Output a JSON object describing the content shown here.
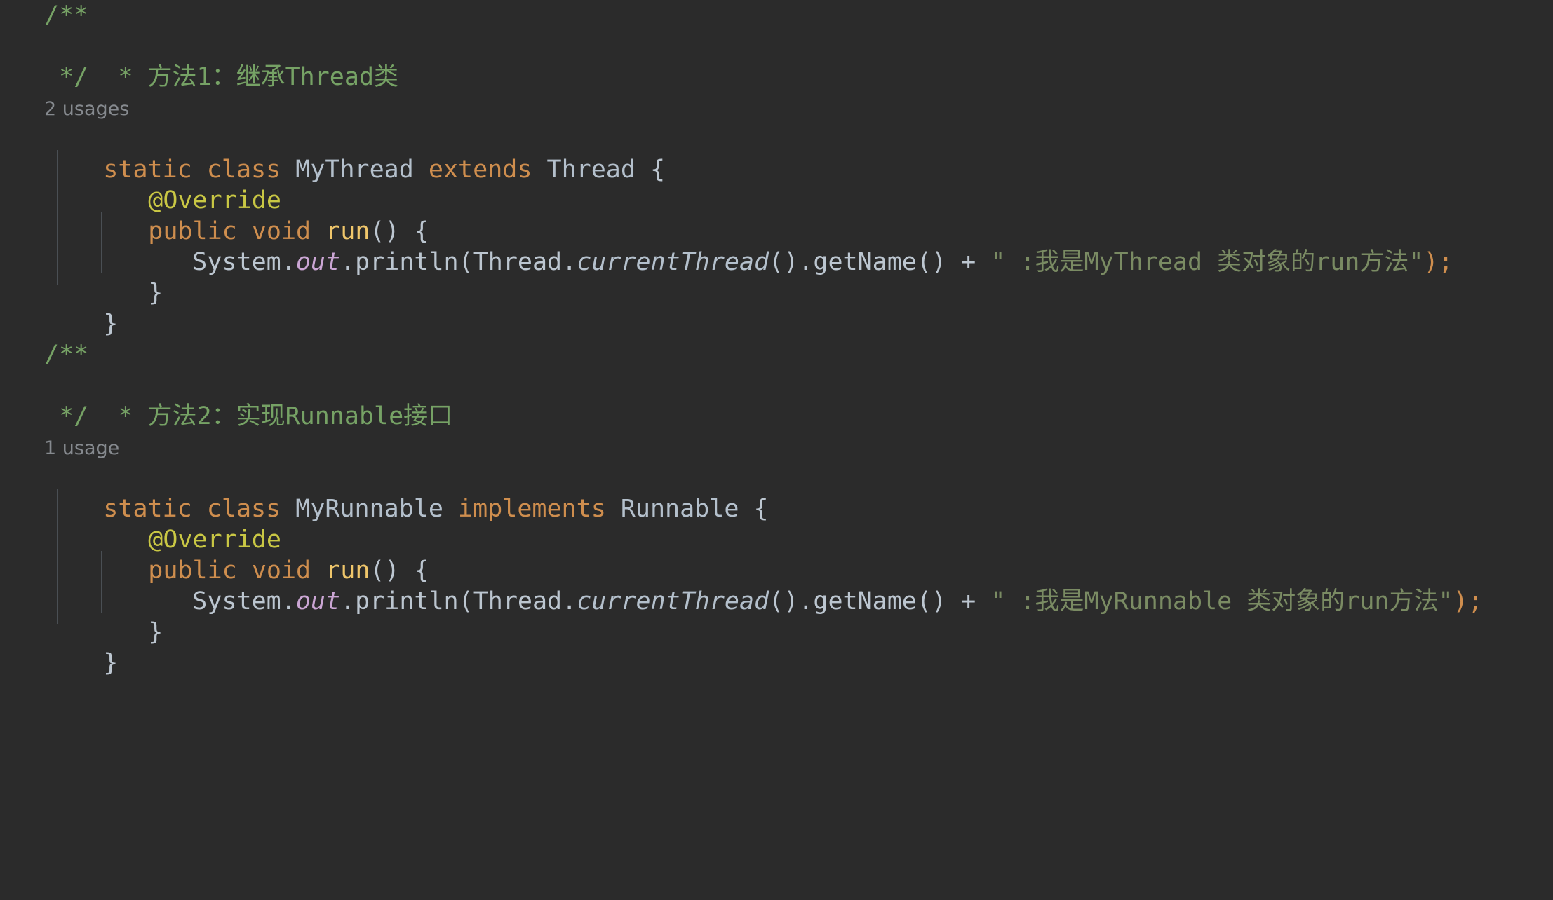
{
  "editor": {
    "theme": "darcula",
    "background": "#2b2b2b",
    "colors": {
      "keyword": "#cf8e4e",
      "identifier": "#b4c0cc",
      "annotation": "#c9c744",
      "method": "#efc66b",
      "static_field": "#cba6d4",
      "string": "#7a8b63",
      "comment": "#76a265",
      "hint": "#868a8f",
      "indent_guide": "#4a4f54"
    }
  },
  "code": {
    "block1": {
      "comment_open": "/**",
      "comment_body": " * 方法1：继承Thread类",
      "comment_close": " */",
      "usages_hint": "2 usages",
      "decl_static": "static",
      "decl_class": "class",
      "decl_name": "MyThread",
      "decl_extends": "extends",
      "decl_super": "Thread",
      "decl_brace": "{",
      "annotation": "@Override",
      "method_public": "public",
      "method_void": "void",
      "method_name": "run",
      "method_parens": "()",
      "method_brace": "{",
      "stmt_system": "System",
      "stmt_out": "out",
      "stmt_println": "println",
      "stmt_thread": "Thread",
      "stmt_current": "currentThread",
      "stmt_getname": "getName",
      "stmt_plus": "+",
      "stmt_string": "\" :我是MyThread 类对象的run方法\"",
      "stmt_tail": ");",
      "close_method": "}",
      "close_class": "}"
    },
    "block2": {
      "comment_open": "/**",
      "comment_body": " * 方法2：实现Runnable接口",
      "comment_close": " */",
      "usages_hint": "1 usage",
      "decl_static": "static",
      "decl_class": "class",
      "decl_name": "MyRunnable",
      "decl_implements": "implements",
      "decl_super": "Runnable",
      "decl_brace": "{",
      "annotation": "@Override",
      "method_public": "public",
      "method_void": "void",
      "method_name": "run",
      "method_parens": "()",
      "method_brace": "{",
      "stmt_system": "System",
      "stmt_out": "out",
      "stmt_println": "println",
      "stmt_thread": "Thread",
      "stmt_current": "currentThread",
      "stmt_getname": "getName",
      "stmt_plus": "+",
      "stmt_string": "\" :我是MyRunnable 类对象的run方法\"",
      "stmt_tail": ");",
      "close_method": "}",
      "close_class": "}"
    }
  }
}
